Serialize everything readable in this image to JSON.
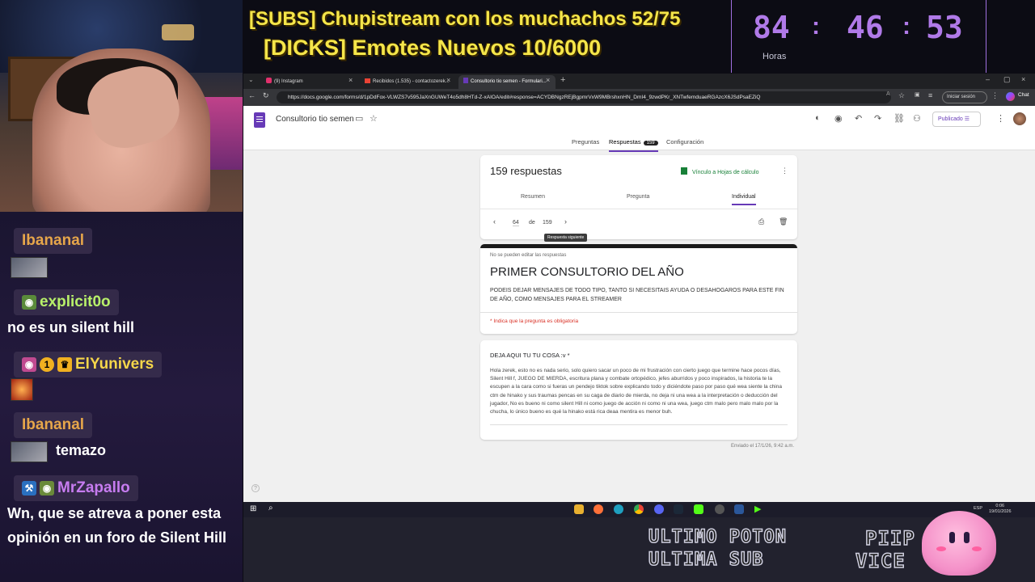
{
  "overlay": {
    "subs_goal": "[SUBS] Chupistream con los muchachos 52/75",
    "emotes_goal": "[DICKS] Emotes Nuevos 10/6000",
    "timer": {
      "hours": "84",
      "minutes": "46",
      "seconds": "53",
      "hours_label": "Horas"
    },
    "bottom_text_1": "ULTIMO POTON",
    "bottom_text_2": "ULTIMA SUB",
    "bottom_text_3": "PIIP",
    "bottom_text_4": "VICE"
  },
  "chat": {
    "messages": [
      {
        "user": "Ibananal",
        "text": "",
        "color": "#e6a64a"
      },
      {
        "user": "explicit0o",
        "text": "no es un silent hill",
        "color": "#b8f06a"
      },
      {
        "user": "ElYunivers",
        "text": "",
        "color": "#f5d64a",
        "badge": "1"
      },
      {
        "user": "Ibananal",
        "text": "temazo",
        "color": "#e6a64a"
      },
      {
        "user": "MrZapallo",
        "text": "Wn, que se atreva a poner esta opinión en un foro de Silent Hill",
        "color": "#c77cf0"
      }
    ]
  },
  "browser": {
    "tabs": [
      {
        "label": "(9) Instagram"
      },
      {
        "label": "Recibidos (1.535) - contactozerek..."
      },
      {
        "label": "Consultorio tio semen - Formulari..."
      }
    ],
    "url": "https://docs.google.com/forms/d/1pDdFox-VLWZS7v595JaXnGUWeT4o5dh8HTd-Z-xAIOA/edit#response=ACYDBNgzREjBgpmrVxW9MBrshxnHN_DmI4_9zwdPKr_XNTwfemduaeRGAzcX6JSdPsaEZiQ",
    "signin_label": "Iniciar sesión",
    "chat_label": "Chat"
  },
  "form": {
    "doc_title": "Consultorio tio semen",
    "publish_label": "Publicado",
    "tabs": {
      "questions": "Preguntas",
      "responses": "Respuestas",
      "responses_count": "159",
      "settings": "Configuración"
    },
    "responses_title": "159 respuestas",
    "sheets_link": "Vínculo a Hojas de cálculo",
    "subtabs": {
      "summary": "Resumen",
      "question": "Pregunta",
      "individual": "Individual"
    },
    "pager": {
      "current": "64",
      "of": "de",
      "total": "159"
    },
    "tooltip": "Respuesta siguiente",
    "no_edit": "No se pueden editar las respuestas",
    "title": "PRIMER CONSULTORIO DEL AÑO",
    "description": "PODEIS DEJAR MENSAJES DE TODO TIPO, TANTO SI NECESITAIS AYUDA O DESAHOGAROS PARA ESTE FIN DE AÑO, COMO MENSAJES PARA EL STREAMER",
    "required_note": "* Indica que la pregunta es obligatoria",
    "question": "DEJA AQUI TU TU COSA :v *",
    "answer": "Hola zerek, esto no es nada serio, solo quiero sacar un poco de mi frustración con cierto juego que termine hace pocos días, Silent Hill f, JUEGO DE MIERDA, escritura plana y combate ortopédico, jefes aburridos y poco inspirados, la historia te la escupen a la cara como si fueras un pendejo tiktok sobre explicando todo y diciéndote paso por paso qué wea siente la china ctm de hinako y sus traumas pencas en su caga de diario de mierda, no deja ni una wea a la interpretación o deducción del jugador, No es bueno ni como silent Hill ni como juego de acción ni como ni una wea, juego ctm malo pero malo malo por la chucha, lo único bueno es qué la hinako está rica deaa mentira es menor buh.",
    "sent": "Enviado el 17/1/26, 9:42 a.m."
  },
  "taskbar": {
    "time": "0:06",
    "date": "19/01/2026",
    "lang": "ESP"
  }
}
